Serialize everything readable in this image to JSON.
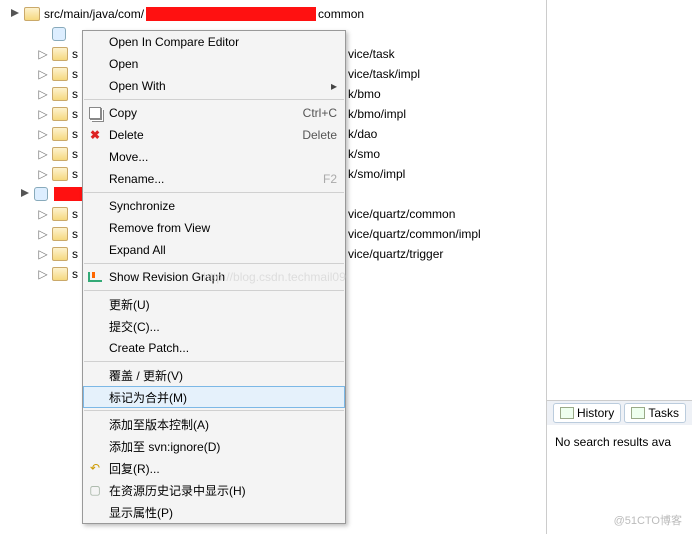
{
  "tree": {
    "root_prefix": "src/main/java/com/",
    "root_suffix": "common",
    "items": [
      "vice/task",
      "vice/task/impl",
      "k/bmo",
      "k/bmo/impl",
      "k/dao",
      "k/smo",
      "k/smo/impl",
      "",
      "vice/quartz/common",
      "vice/quartz/common/impl",
      "vice/quartz/trigger",
      ""
    ],
    "trunc": "s"
  },
  "menu": {
    "open_compare": "Open In Compare Editor",
    "open": "Open",
    "open_with": "Open With",
    "copy": "Copy",
    "copy_k": "Ctrl+C",
    "delete": "Delete",
    "delete_k": "Delete",
    "move": "Move...",
    "rename": "Rename...",
    "rename_k": "F2",
    "sync": "Synchronize",
    "remove": "Remove from View",
    "expand": "Expand All",
    "rev": "Show Revision Graph",
    "update": "更新(U)",
    "commit": "提交(C)...",
    "patch": "Create Patch...",
    "override": "覆盖 / 更新(V)",
    "mark": "标记为合并(M)",
    "addvc": "添加至版本控制(A)",
    "addign": "添加至 svn:ignore(D)",
    "revert": "回复(R)...",
    "hist": "在资源历史记录中显示(H)",
    "props": "显示属性(P)"
  },
  "right": {
    "history": "History",
    "tasks": "Tasks",
    "nores": "No search results ava"
  },
  "watermark": "@51CTO博客",
  "ghost": "http://blog.csdn.techmail09"
}
